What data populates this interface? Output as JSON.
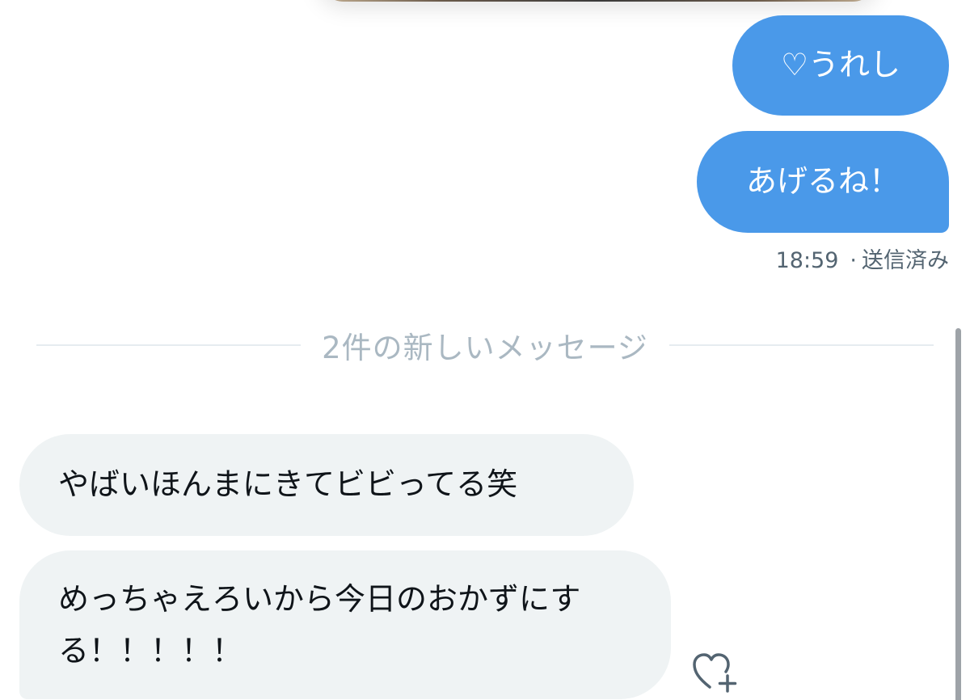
{
  "conversation": {
    "sent_messages": [
      {
        "text": "♡うれし"
      },
      {
        "text": "あげるね！"
      }
    ],
    "sent_meta": {
      "time": "18:59",
      "separator": "·",
      "status": "送信済み"
    },
    "new_messages_divider": "2件の新しいメッセージ",
    "received_messages": [
      {
        "text": "やばいほんまにきてビビってる笑"
      },
      {
        "text": "めっちゃえろいから今日のおかずにする！！！！！"
      }
    ]
  },
  "colors": {
    "sent_bubble": "#4a99e9",
    "received_bubble": "#eff3f4",
    "meta_text": "#536471",
    "divider_text": "#aab8c2"
  },
  "icons": {
    "like_button": "heart-plus-icon"
  }
}
